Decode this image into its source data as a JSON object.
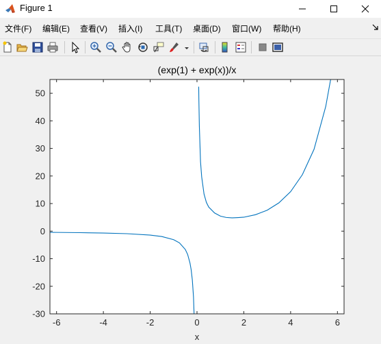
{
  "window": {
    "title": "Figure 1"
  },
  "menu": [
    "文件(F)",
    "编辑(E)",
    "查看(V)",
    "插入(I)",
    "工具(T)",
    "桌面(D)",
    "窗口(W)",
    "帮助(H)"
  ],
  "toolbar": {
    "icons": [
      "new-figure-icon",
      "open-file-icon",
      "save-icon",
      "print-icon",
      "edit-plot-icon",
      "zoom-in-icon",
      "zoom-out-icon",
      "pan-icon",
      "rotate-3d-icon",
      "data-cursor-icon",
      "brush-icon",
      "link-plot-icon",
      "insert-colorbar-icon",
      "insert-legend-icon",
      "hide-plot-tools-icon",
      "show-plot-tools-icon"
    ]
  },
  "chart_data": {
    "type": "line",
    "title": "(exp(1) + exp(x))/x",
    "xlabel": "x",
    "ylabel": "",
    "xlim": [
      -6.2832,
      6.2832
    ],
    "ylim": [
      -30,
      55
    ],
    "xticks": [
      -6,
      -4,
      -2,
      0,
      2,
      4,
      6
    ],
    "yticks": [
      -30,
      -20,
      -10,
      0,
      10,
      20,
      30,
      40,
      50
    ],
    "grid": false,
    "series": [
      {
        "color": "#0072bd",
        "segments": [
          {
            "x": [
              -6.2832,
              -6,
              -5,
              -4,
              -3,
              -2,
              -1.5,
              -1,
              -0.75,
              -0.5,
              -0.4,
              -0.3,
              -0.25,
              -0.2,
              -0.15,
              -0.1,
              -0.0943
            ],
            "y": [
              -0.433,
              -0.453,
              -0.545,
              -0.684,
              -0.923,
              -1.427,
              -1.961,
              -3.086,
              -4.254,
              -6.649,
              -8.443,
              -11.553,
              -13.988,
              -17.683,
              -23.794,
              -36.231,
              -38.5
            ]
          },
          {
            "x": [
              0.0727,
              0.08,
              0.1,
              0.15,
              0.2,
              0.3,
              0.4,
              0.5,
              0.75,
              1,
              1.25,
              1.5,
              1.75,
              2,
              2.5,
              3,
              3.5,
              4,
              4.5,
              5,
              5.5,
              5.75,
              5.9,
              6
            ],
            "y": [
              52.4,
              47.5,
              38.23,
              25.24,
              19.7,
              13.45,
              10.44,
              8.73,
              6.59,
              5.44,
              4.95,
              4.8,
              4.91,
              5.05,
              5.96,
              7.6,
              10.26,
              14.33,
              20.45,
              29.68,
              45.2,
              56.9,
              63.9,
              67.7
            ]
          }
        ]
      }
    ]
  }
}
